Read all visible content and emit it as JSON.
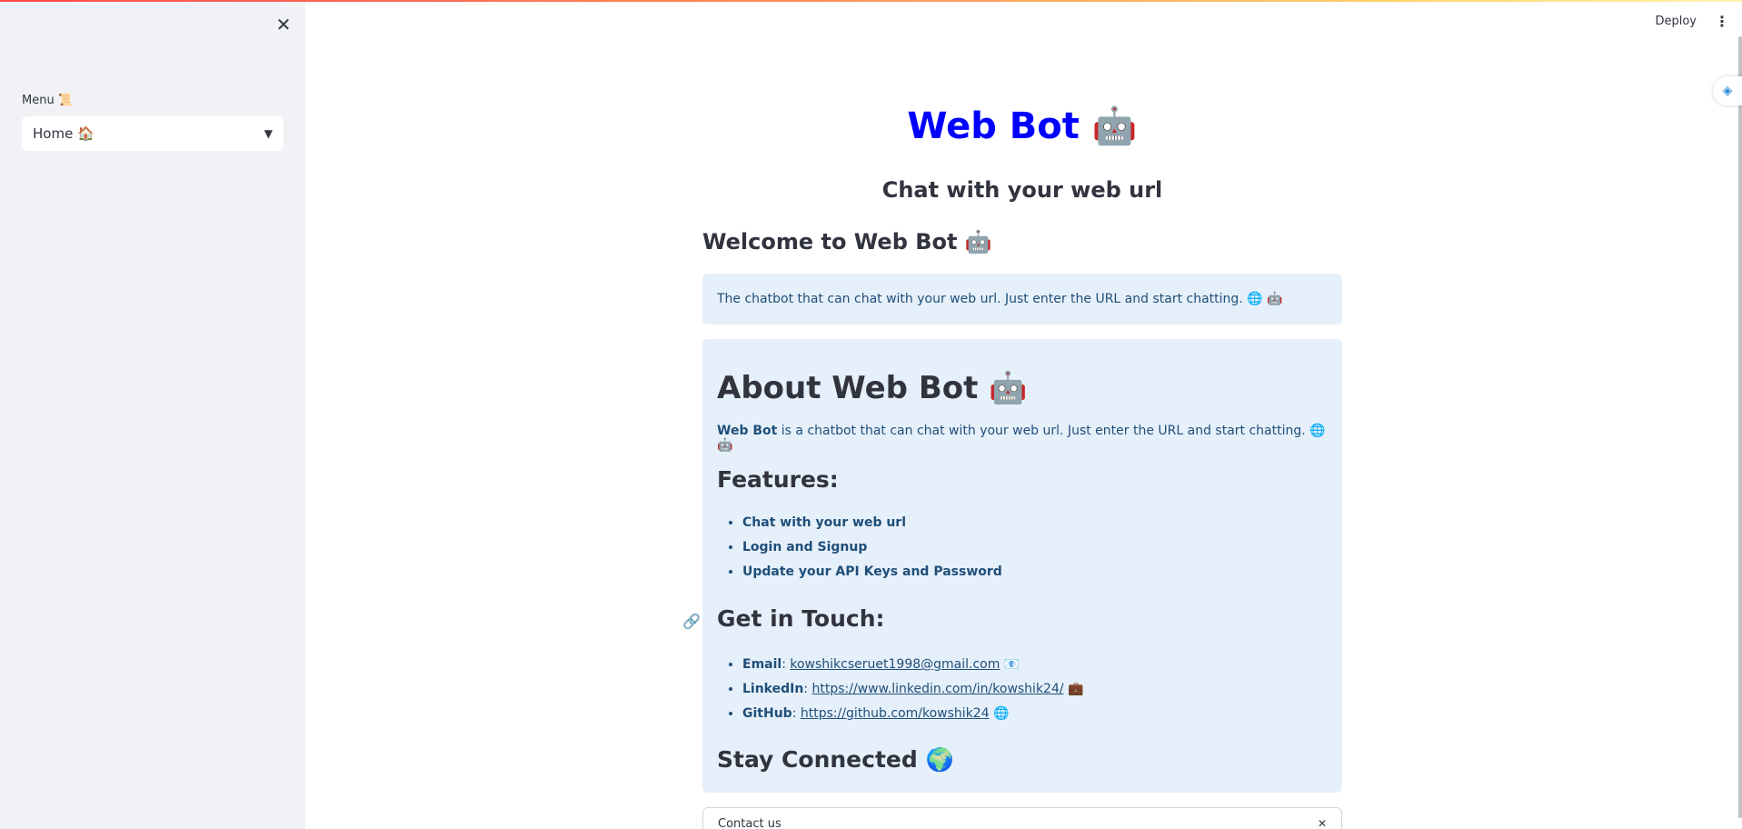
{
  "sidebar": {
    "close_glyph": "✕",
    "menu_label": "Menu 📜",
    "menu_selected": "Home 🏠",
    "menu_chevron": "⌄"
  },
  "header": {
    "deploy_label": "Deploy",
    "kebab_glyph": "⋮"
  },
  "main": {
    "title": "Web Bot 🤖",
    "subtitle": "Chat with your web url",
    "welcome_heading": "Welcome to Web Bot 🤖",
    "info_text": "The chatbot that can chat with your web url. Just enter the URL and start chatting. 🌐 🤖",
    "about": {
      "heading": "About Web Bot 🤖",
      "text_bold": "Web Bot",
      "text_rest": " is a chatbot that can chat with your web url. Just enter the URL and start chatting. 🌐 🤖",
      "features_heading": "Features:",
      "features": [
        "Chat with your web url",
        "Login and Signup",
        "Update your API Keys and Password"
      ],
      "touch_heading": "Get in Touch:",
      "contacts": [
        {
          "label": "Email",
          "link": "kowshikcseruet1998@gmail.com",
          "emoji": "📧"
        },
        {
          "label": "LinkedIn",
          "link": "https://www.linkedin.com/in/kowshik24/",
          "emoji": "💼"
        },
        {
          "label": "GitHub",
          "link": "https://github.com/kowshik24",
          "emoji": "🌐"
        }
      ],
      "stay_heading": "Stay Connected 🌍"
    },
    "contact_expander_label": "Contact us",
    "contact_expander_glyph": "✕"
  },
  "colors": {
    "title": "#0000ff",
    "sidebar_bg": "#f0f2f6",
    "info_bg": "#e6f0fa",
    "info_text": "#1f4e79",
    "accent_red": "#ff4b4b"
  },
  "icons": [
    "close-icon",
    "chevron-down-icon",
    "more-vert-icon",
    "link-icon"
  ]
}
